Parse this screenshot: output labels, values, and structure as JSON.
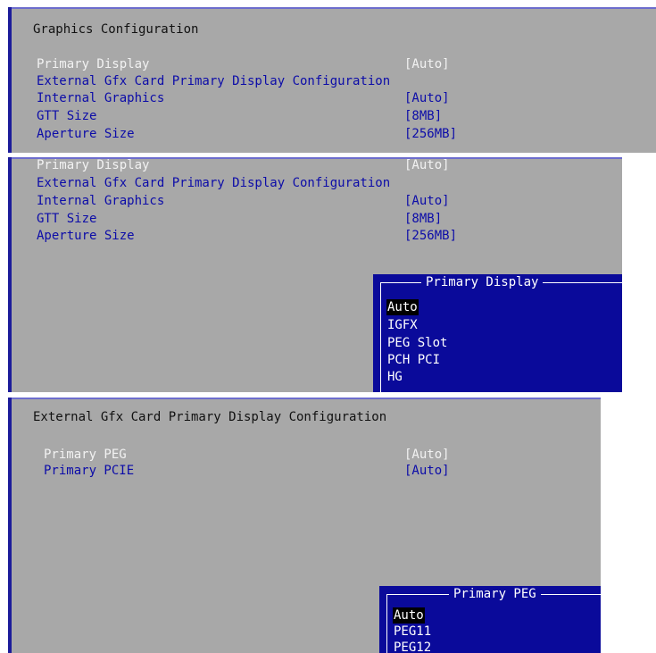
{
  "panel1": {
    "title": "Graphics Configuration",
    "items": [
      {
        "label": "Primary Display",
        "value": "[Auto]"
      },
      {
        "label": "External Gfx Card Primary Display Configuration",
        "submenu_marker": "▶"
      },
      {
        "label": "Internal Graphics",
        "value": "[Auto]"
      },
      {
        "label": "GTT Size",
        "value": "[8MB]"
      },
      {
        "label": "Aperture Size",
        "value": "[256MB]"
      }
    ]
  },
  "panel2": {
    "items": [
      {
        "label": "Primary Display",
        "value": "[Auto]"
      },
      {
        "label": "External Gfx Card Primary Display Configuration",
        "submenu_marker": "▶"
      },
      {
        "label": "Internal Graphics",
        "value": "[Auto]"
      },
      {
        "label": "GTT Size",
        "value": "[8MB]"
      },
      {
        "label": "Aperture Size",
        "value": "[256MB]"
      }
    ],
    "popup": {
      "title": "Primary Display",
      "options": [
        "Auto",
        "IGFX",
        "PEG Slot",
        "PCH PCI",
        "HG"
      ],
      "selected": "Auto"
    }
  },
  "panel3": {
    "title": "External Gfx Card Primary Display Configuration",
    "items": [
      {
        "label": "Primary PEG",
        "value": "[Auto]"
      },
      {
        "label": "Primary PCIE",
        "value": "[Auto]"
      }
    ],
    "popup": {
      "title": "Primary PEG",
      "options": [
        "Auto",
        "PEG11",
        "PEG12"
      ],
      "selected": "Auto"
    }
  },
  "colors": {
    "panel_bg": "#a8a8a8",
    "highlight_text": "#f2f2f2",
    "item_text": "#0c0ca8",
    "popup_bg": "#0a0a9a",
    "selected_bg": "#000000"
  }
}
